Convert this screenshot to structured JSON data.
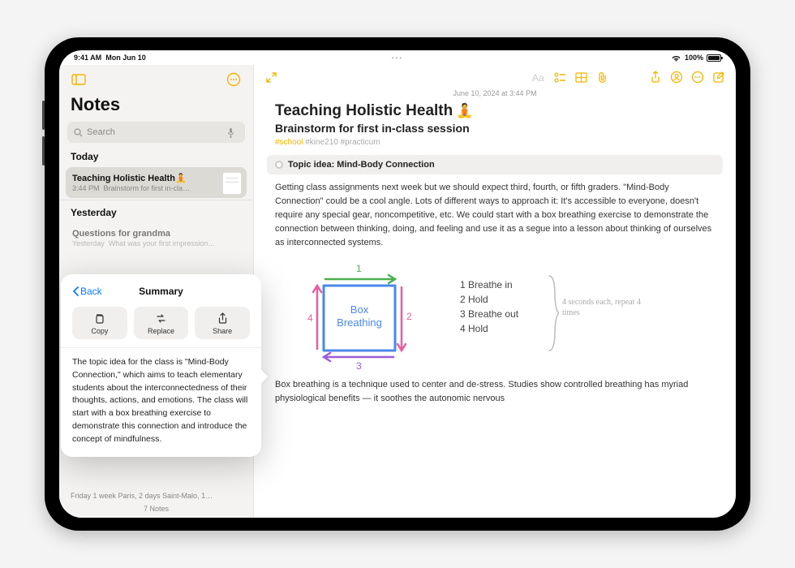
{
  "status": {
    "time": "9:41 AM",
    "date": "Mon Jun 10",
    "battery": "100%"
  },
  "sidebar": {
    "title": "Notes",
    "search_placeholder": "Search",
    "sections": [
      {
        "label": "Today",
        "items": [
          {
            "title": "Teaching Holistic Health",
            "emoji": "🧘",
            "meta_time": "3:44 PM",
            "preview": "Brainstorm for first in-cla…"
          }
        ]
      },
      {
        "label": "Yesterday",
        "items": [
          {
            "title": "Questions for grandma",
            "meta_time": "Yesterday",
            "preview": "What was your first impression…"
          }
        ]
      }
    ],
    "bottom_strip": "Friday  1 week Paris, 2 days Saint-Malo, 1…",
    "count": "7 Notes"
  },
  "popover": {
    "back": "Back",
    "title": "Summary",
    "actions": [
      "Copy",
      "Replace",
      "Share"
    ],
    "text": "The topic idea for the class is \"Mind-Body Connection,\" which aims to teach elementary students about the interconnectedness of their thoughts, actions, and emotions. The class will start with a box breathing exercise to demonstrate this connection and introduce the concept of mindfulness."
  },
  "note": {
    "date": "June 10, 2024 at 3:44 PM",
    "title": "Teaching Holistic Health",
    "title_emoji": "🧘",
    "subtitle": "Brainstorm for first in-class session",
    "tags": [
      "#school",
      "#kine210",
      "#practicum"
    ],
    "topic_idea": "Topic idea: Mind-Body Connection",
    "p1": "Getting class assignments next week but we should expect third, fourth, or fifth graders. \"Mind-Body Connection\" could be a cool angle. Lots of different ways to approach it: It's accessible to everyone, doesn't require any special gear, noncompetitive, etc. We could start with a box breathing exercise to demonstrate the connection between thinking, doing, and feeling and use it as a segue into a lesson about thinking of ourselves as interconnected systems.",
    "drawing": {
      "box_label": "Box\nBreathing",
      "arrows": [
        "1",
        "2",
        "3",
        "4"
      ],
      "steps": [
        "Breathe in",
        "Hold",
        "Breathe out",
        "Hold"
      ],
      "side_note": "4 seconds each, repeat 4 times"
    },
    "p2": "Box breathing is a technique used to center and de-stress. Studies show controlled breathing has myriad physiological benefits — it soothes the autonomic nervous"
  }
}
